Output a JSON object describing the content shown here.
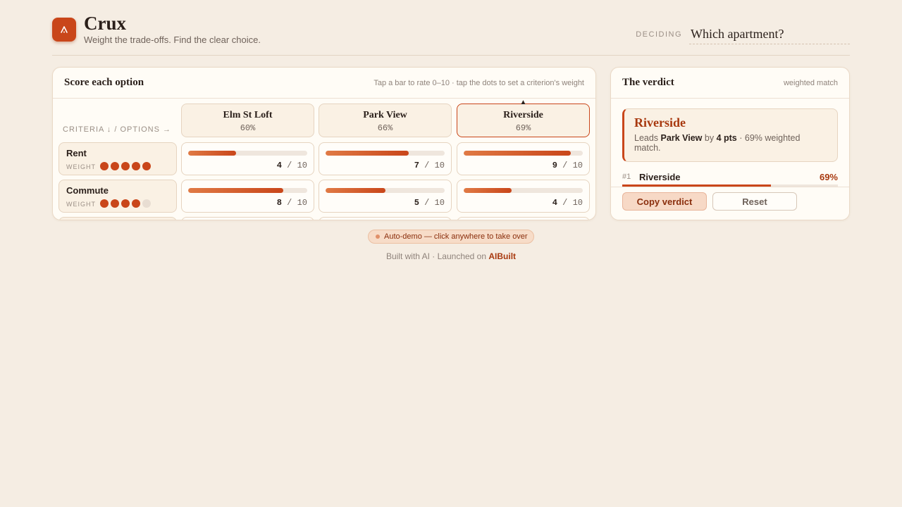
{
  "app": {
    "title": "Crux",
    "tagline": "Weight the trade-offs. Find the clear choice.",
    "deciding_label": "DECIDING",
    "question": "Which apartment?"
  },
  "score_panel": {
    "title": "Score each option",
    "hint": "Tap a bar to rate 0–10 · tap the dots to set a criterion's weight",
    "axis_label": "CRITERIA ↓ / OPTIONS →",
    "options": [
      {
        "name": "Elm St Loft",
        "pct": "60%",
        "leader": false
      },
      {
        "name": "Park View",
        "pct": "66%",
        "leader": false
      },
      {
        "name": "Riverside",
        "pct": "69%",
        "leader": true
      }
    ],
    "leader_marker": "▲",
    "weight_label": "WEIGHT",
    "max_score": "10",
    "criteria": [
      {
        "name": "Rent",
        "weight": 5,
        "scores": [
          4,
          7,
          9
        ]
      },
      {
        "name": "Commute",
        "weight": 4,
        "scores": [
          8,
          5,
          4
        ]
      }
    ]
  },
  "verdict_panel": {
    "title": "The verdict",
    "hint": "weighted match",
    "leader": {
      "name": "Riverside",
      "desc_prefix": "Leads",
      "runner_up": "Park View",
      "desc_by": "by",
      "margin": "4 pts",
      "desc_suffix": "· 69% weighted match."
    },
    "ranking": [
      {
        "rank": "#1",
        "name": "Riverside",
        "pct": "69%",
        "fraction": 0.69
      }
    ],
    "copy_label": "Copy verdict",
    "reset_label": "Reset"
  },
  "demo_banner": "Auto-demo — click anywhere to take over",
  "footer": {
    "text": "Built with AI · Launched on",
    "link": "AIBuilt"
  },
  "colors": {
    "accent": "#c9461a",
    "background": "#f5ede3"
  }
}
